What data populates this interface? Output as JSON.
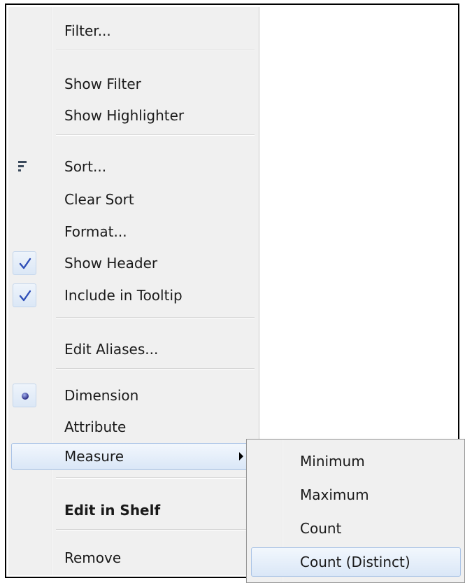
{
  "menu": {
    "filter": "Filter...",
    "show_filter": "Show Filter",
    "show_highlighter": "Show Highlighter",
    "sort": "Sort...",
    "clear_sort": "Clear Sort",
    "format": "Format...",
    "show_header": "Show Header",
    "include_in_tooltip": "Include in Tooltip",
    "edit_aliases": "Edit Aliases...",
    "dimension": "Dimension",
    "attribute": "Attribute",
    "measure": "Measure",
    "edit_in_shelf": "Edit in Shelf",
    "remove": "Remove"
  },
  "state": {
    "show_header_checked": true,
    "include_in_tooltip_checked": true,
    "selected_role": "Dimension"
  },
  "submenu": {
    "minimum": "Minimum",
    "maximum": "Maximum",
    "count": "Count",
    "count_distinct": "Count (Distinct)"
  },
  "colors": {
    "accent": "#3a5fcd",
    "hover_border": "#a9c3e6",
    "menu_bg": "#f0f0f0"
  }
}
